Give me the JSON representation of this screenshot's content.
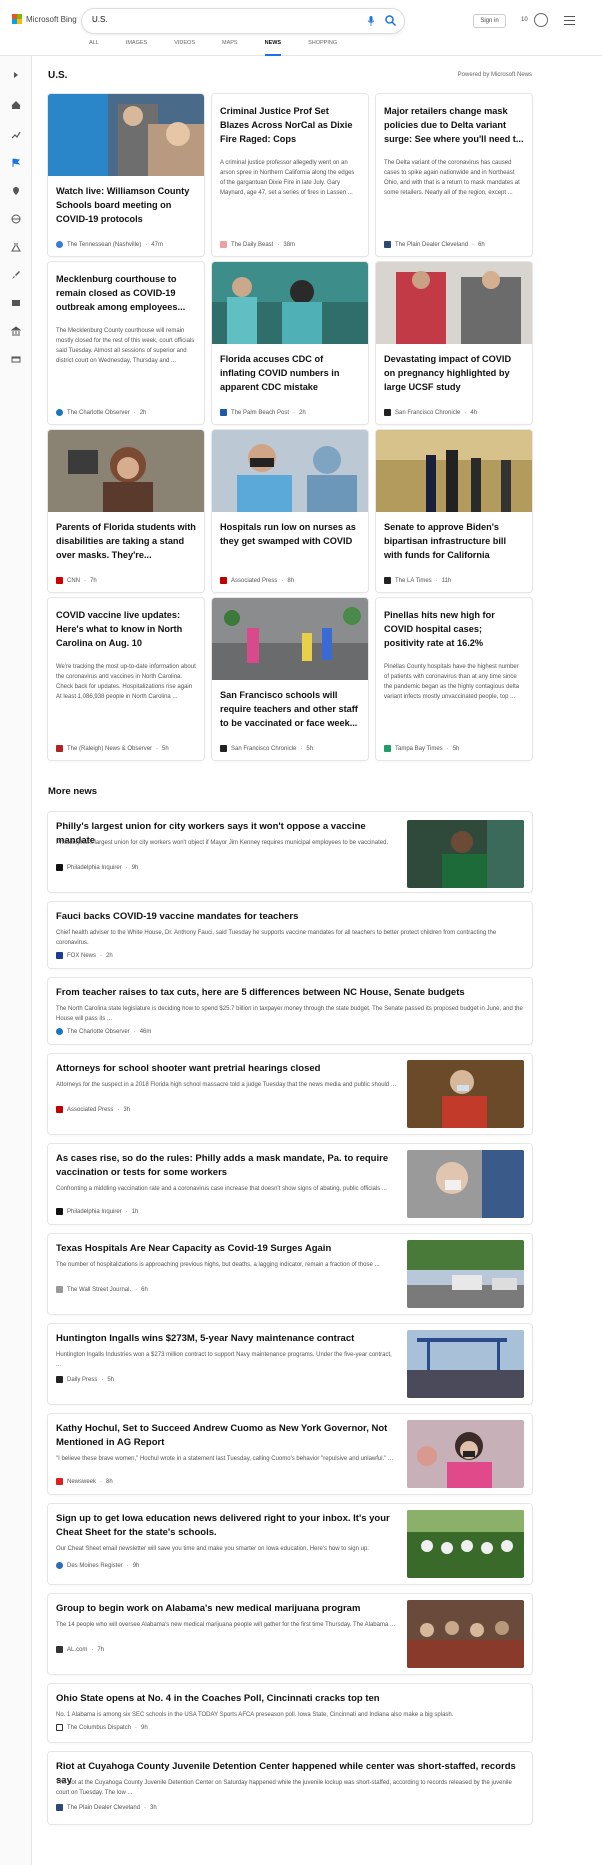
{
  "header": {
    "logo_text": "Microsoft Bing",
    "search_value": "U.S.",
    "signin_label": "Sign in",
    "rewards_count": "10"
  },
  "nav": [
    "ALL",
    "IMAGES",
    "VIDEOS",
    "MAPS",
    "NEWS",
    "SHOPPING"
  ],
  "section": {
    "title": "U.S.",
    "powered": "Powered by Microsoft News"
  },
  "cards": [
    {
      "title": "Watch live: Williamson County Schools board meeting on COVID-19 protocols",
      "snippet": "",
      "source": "The Tennessean (Nashville)",
      "time": "47m",
      "src_color": "#3a7bd5"
    },
    {
      "title": "Criminal Justice Prof Set Blazes Across NorCal as Dixie Fire Raged: Cops",
      "snippet": "A criminal justice professor allegedly went on an arson spree in Northern California along the edges of the gargantuan Dixie Fire in late July. Gary Maynard, age 47, set a series of fires in Lassen ...",
      "source": "The Daily Beast",
      "time": "38m",
      "src_color": "#f0a0a0"
    },
    {
      "title": "Major retailers change mask policies due to Delta variant surge: See where you'll need t...",
      "snippet": "The Delta variant of the coronavirus has caused cases to spike again nationwide and in Northeast Ohio, and with that is a return to mask mandates at some retailers. Nearly all of the region, except ...",
      "source": "The Plain Dealer Cleveland",
      "time": "6h",
      "src_color": "#2b4a7a"
    },
    {
      "title": "Mecklenburg courthouse to remain closed as COVID-19 outbreak among employees...",
      "snippet": "The Mecklenburg County courthouse will remain mostly closed for the rest of this week, court officials said Tuesday. Almost all sessions of superior and district court on Wednesday, Thursday and ...",
      "source": "The Charlotte Observer",
      "time": "2h",
      "src_color": "#1b75bb"
    },
    {
      "title": "Florida accuses CDC of inflating COVID numbers in apparent CDC mistake",
      "snippet": "",
      "source": "The Palm Beach Post",
      "time": "2h",
      "src_color": "#1a5aa8"
    },
    {
      "title": "Devastating impact of COVID on pregnancy highlighted by large UCSF study",
      "snippet": "",
      "source": "San Francisco Chronicle",
      "time": "4h",
      "src_color": "#222222"
    },
    {
      "title": "Parents of Florida students with disabilities are taking a stand over masks. They're...",
      "snippet": "",
      "source": "CNN",
      "time": "7h",
      "src_color": "#cc0000"
    },
    {
      "title": "Hospitals run low on nurses as they get swamped with COVID",
      "snippet": "",
      "source": "Associated Press",
      "time": "8h",
      "src_color": "#c00000"
    },
    {
      "title": "Senate to approve Biden's bipartisan infrastructure bill with funds for California",
      "snippet": "",
      "source": "The LA Times",
      "time": "11h",
      "src_color": "#222222"
    },
    {
      "title": "COVID vaccine live updates: Here's what to know in North Carolina on Aug. 10",
      "snippet": "We're tracking the most up-to-date information about the coronavirus and vaccines in North Carolina. Check back for updates. Hospitalizations rise again At least 1,086,938 people in North Carolina ...",
      "source": "The (Raleigh) News & Observer",
      "time": "5h",
      "src_color": "#b22222"
    },
    {
      "title": "San Francisco schools will require teachers and other staff to be vaccinated or face week...",
      "snippet": "",
      "source": "San Francisco Chronicle",
      "time": "5h",
      "src_color": "#222222"
    },
    {
      "title": "Pinellas hits new high for COVID hospital cases; positivity rate at 16.2%",
      "snippet": "Pinellas County hospitals have the highest number of patients with coronavirus than at any time since the pandemic began as the highly contagious delta variant infects mostly unvaccinated people, top ...",
      "source": "Tampa Bay Times",
      "time": "5h",
      "src_color": "#1e9e6a"
    }
  ],
  "more_news_title": "More news",
  "more_news": [
    {
      "title": "Philly's largest union for city workers says it won't oppose a vaccine mandate",
      "snippet": "Philadelphia's largest union for city workers won't object if Mayor Jim Kenney requires municipal employees to be vaccinated.",
      "source": "Philadelphia Inquirer",
      "time": "9h",
      "src_color": "#111111"
    },
    {
      "title": "Fauci backs COVID-19 vaccine mandates for teachers",
      "snippet": "Chief health adviser to the White House, Dr. Anthony Fauci, said Tuesday he supports vaccine mandates for all teachers to better protect children from contracting the coronavirus.",
      "source": "FOX News",
      "time": "2h",
      "src_color": "#1c3f94"
    },
    {
      "title": "From teacher raises to tax cuts, here are 5 differences between NC House, Senate budgets",
      "snippet": "The North Carolina state legislature is deciding how to spend $25.7 billion in taxpayer money through the state budget. The Senate passed its proposed budget in June, and the House will pass its ...",
      "source": "The Charlotte Observer",
      "time": "46m",
      "src_color": "#1b75bb"
    },
    {
      "title": "Attorneys for school shooter want pretrial hearings closed",
      "snippet": "Attorneys for the suspect in a 2018 Florida high school massacre told a judge Tuesday that the news media and public should ...",
      "source": "Associated Press",
      "time": "3h",
      "src_color": "#c00000"
    },
    {
      "title": "As cases rise, so do the rules: Philly adds a mask mandate, Pa. to require vaccination or tests for some workers",
      "snippet": "Confronting a middling vaccination rate and a coronavirus case increase that doesn't show signs of abating, public officials ...",
      "source": "Philadelphia Inquirer",
      "time": "1h",
      "src_color": "#111111"
    },
    {
      "title": "Texas Hospitals Are Near Capacity as Covid-19 Surges Again",
      "snippet": "The number of hospitalizations is approaching previous highs, but deaths, a lagging indicator, remain a fraction of those ...",
      "source": "The Wall Street Journal.",
      "time": "6h",
      "src_color": "#999999"
    },
    {
      "title": "Huntington Ingalls wins $273M, 5-year Navy maintenance contract",
      "snippet": "Huntington Ingalls Industries won a $273 million contract to support Navy maintenance programs. Under the five-year contract, ...",
      "source": "Daily Press",
      "time": "5h",
      "src_color": "#222222"
    },
    {
      "title": "Kathy Hochul, Set to Succeed Andrew Cuomo as New York Governor, Not Mentioned in AG Report",
      "snippet": "\"I believe these brave women,\" Hochul wrote in a statement last Tuesday, calling Cuomo's behavior \"repulsive and unlawful.\" ...",
      "source": "Newsweek",
      "time": "8h",
      "src_color": "#e02020"
    },
    {
      "title": "Sign up to get Iowa education news delivered right to your inbox. It's your Cheat Sheet for the state's schools.",
      "snippet": "Our Cheat Sheet email newsletter will save you time and make you smarter on Iowa education. Here's how to sign up.",
      "source": "Des Moines Register",
      "time": "9h",
      "src_color": "#2a6fb5"
    },
    {
      "title": "Group to begin work on Alabama's new medical marijuana program",
      "snippet": "The 14 people who will oversee Alabama's new medical marijuana people will gather for the first time Thursday. The Alabama ...",
      "source": "AL.com",
      "time": "7h",
      "src_color": "#333333"
    },
    {
      "title": "Ohio State opens at No. 4 in the Coaches Poll, Cincinnati cracks top ten",
      "snippet": "No. 1 Alabama is among six SEC schools in the USA TODAY Sports AFCA preseason poll. Iowa State, Cincinnati and Indiana also make a big splash.",
      "source": "The Columbus Dispatch",
      "time": "9h",
      "src_color": "#ffffff"
    },
    {
      "title": "Riot at Cuyahoga County Juvenile Detention Center happened while center was short-staffed, records say",
      "snippet": "The riot at the Cuyahoga County Juvenile Detention Center on Saturday happened while the juvenile lockup was short-staffed, according to records released by the juvenile court on Tuesday. The low ...",
      "source": "The Plain Dealer Cleveland",
      "time": "3h",
      "src_color": "#2b4a7a"
    }
  ],
  "colors": {
    "accent": "#1a73e8",
    "border": "#e6e6e6"
  }
}
